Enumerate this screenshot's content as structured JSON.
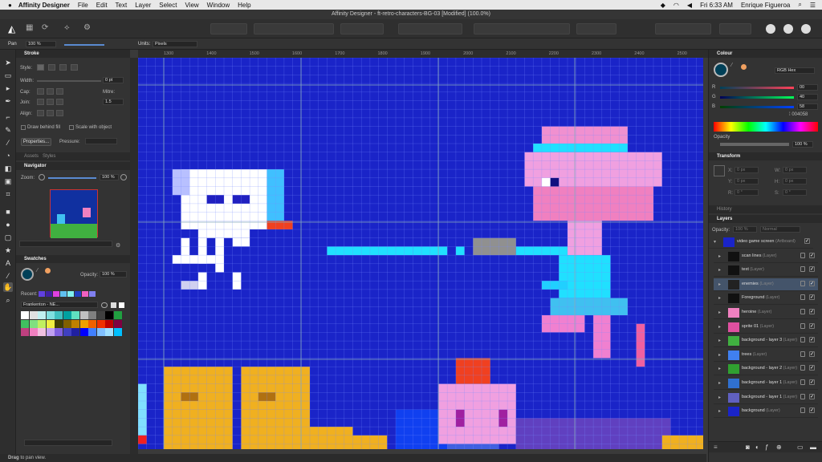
{
  "menubar": {
    "app": "Affinity Designer",
    "items": [
      "File",
      "Edit",
      "Text",
      "Layer",
      "Select",
      "View",
      "Window",
      "Help"
    ],
    "clock": "Fri 6:33 AM",
    "user": "Enrique Figueroa"
  },
  "titlebar": {
    "title": "Affinity Designer - ft-retro-characters-BG-03 [Modified] (100.0%)"
  },
  "context": {
    "tool": "Pan",
    "zoom": "100 %",
    "units_label": "Units:",
    "units_value": "Pixels"
  },
  "stroke_panel": {
    "title": "Stroke",
    "style_label": "Style:",
    "width_label": "Width:",
    "width_value": "0 pt",
    "cap_label": "Cap:",
    "join_label": "Join:",
    "mitre_label": "Mitre:",
    "mitre_value": "1.5",
    "align_label": "Align:",
    "draw_behind": "Draw behind fill",
    "scale_with": "Scale with object",
    "properties_btn": "Properties...",
    "pressure_label": "Pressure:"
  },
  "assets_tabs": [
    "Assets",
    "Styles"
  ],
  "navigator": {
    "title": "Navigator",
    "zoom_label": "Zoom:",
    "zoom_value": "100 %"
  },
  "swatches": {
    "title": "Swatches",
    "opacity_label": "Opacity:",
    "opacity_value": "100 %",
    "recent_label": "Recent:",
    "palette_name": "Frankenton - NE..."
  },
  "colour_panel": {
    "title": "Colour",
    "mode": "RGB Hex",
    "r_label": "R",
    "r_value": "00",
    "g_label": "G",
    "g_value": "40",
    "b_label": "B",
    "b_value": "58",
    "hex_value": "004058",
    "opacity_label": "Opacity",
    "opacity_value": "100 %",
    "accent": "#004058"
  },
  "transform_panel": {
    "title": "Transform",
    "x_label": "X:",
    "x_value": "0 px",
    "y_label": "Y:",
    "y_value": "0 px",
    "w_label": "W:",
    "w_value": "0 px",
    "h_label": "H:",
    "h_value": "0 px",
    "r_label": "R:",
    "r_value": "0 °",
    "s_label": "S:",
    "s_value": "0 °"
  },
  "history_title": "History",
  "layers_panel": {
    "title": "Layers",
    "opacity_label": "Opacity:",
    "opacity_value": "100 %",
    "blend": "Normal",
    "layers": [
      {
        "name": "video game screen",
        "type": "(Artboard)"
      },
      {
        "name": "scan lines",
        "type": "(Layer)"
      },
      {
        "name": "text",
        "type": "(Layer)"
      },
      {
        "name": "enemies",
        "type": "(Layer)"
      },
      {
        "name": "Foreground",
        "type": "(Layer)"
      },
      {
        "name": "heroine",
        "type": "(Layer)"
      },
      {
        "name": "sprite 01",
        "type": "(Layer)"
      },
      {
        "name": "background - layer 3",
        "type": "(Layer)"
      },
      {
        "name": "trees",
        "type": "(Layer)"
      },
      {
        "name": "background - layer 2",
        "type": "(Layer)"
      },
      {
        "name": "background - layer 1",
        "type": "(Layer)"
      },
      {
        "name": "background - layer 1",
        "type": "(Layer)"
      },
      {
        "name": "background",
        "type": "(Layer)"
      }
    ]
  },
  "ruler_ticks": [
    "1300",
    "1400",
    "1500",
    "1600",
    "1700",
    "1800",
    "1900",
    "2000",
    "2100",
    "2200",
    "2300",
    "2400",
    "2500"
  ],
  "status": {
    "bold": "Drag",
    "text": " to pan view."
  },
  "palette_colors": [
    "#ffffff",
    "#e0e0e0",
    "#c0f0f0",
    "#80e0e0",
    "#40c0c0",
    "#00a0a0",
    "#60e0c0",
    "#c0c0c0",
    "#808080",
    "#404040",
    "#000000",
    "#20a040",
    "#40c060",
    "#80e080",
    "#c0f060",
    "#f0f040",
    "#404000",
    "#806000",
    "#c08000",
    "#f0a000",
    "#f06000",
    "#f03000",
    "#c00000",
    "#800040",
    "#c04080",
    "#f080c0",
    "#f0c0e0",
    "#c0a0f0",
    "#8060e0",
    "#4040c0",
    "#2020a0",
    "#0000ff",
    "#4080ff",
    "#80c0ff",
    "#a0e0ff",
    "#00c0ff"
  ],
  "recent_colors": [
    "#6040e0",
    "#4020a0",
    "#e040e0",
    "#60c0f0",
    "#80f0f0",
    "#2040c0",
    "#f060c0",
    "#8080f0"
  ]
}
